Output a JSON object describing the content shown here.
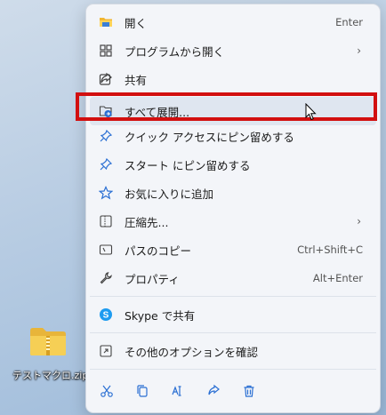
{
  "desktop": {
    "file_label": "テストマクロ.zip"
  },
  "menu": {
    "items": [
      {
        "label": "開く",
        "shortcut": "Enter",
        "icon": "folder-open-icon"
      },
      {
        "label": "プログラムから開く",
        "shortcut": "",
        "icon": "apps-icon",
        "submenu": true
      },
      {
        "label": "共有",
        "shortcut": "",
        "icon": "share-icon"
      },
      {
        "label": "すべて展開...",
        "shortcut": "",
        "icon": "extract-all-icon"
      },
      {
        "label": "クイック アクセスにピン留めする",
        "shortcut": "",
        "icon": "pin-icon"
      },
      {
        "label": "スタート にピン留めする",
        "shortcut": "",
        "icon": "pin-icon"
      },
      {
        "label": "お気に入りに追加",
        "shortcut": "",
        "icon": "star-icon"
      },
      {
        "label": "圧縮先...",
        "shortcut": "",
        "icon": "compress-icon",
        "submenu": true
      },
      {
        "label": "パスのコピー",
        "shortcut": "Ctrl+Shift+C",
        "icon": "copy-path-icon"
      },
      {
        "label": "プロパティ",
        "shortcut": "Alt+Enter",
        "icon": "wrench-icon"
      },
      {
        "label": "Skype で共有",
        "shortcut": "",
        "icon": "skype-icon"
      },
      {
        "label": "その他のオプションを確認",
        "shortcut": "",
        "icon": "more-options-icon"
      }
    ],
    "submenu_arrow": "›"
  },
  "colors": {
    "highlight_border": "#d20f0f",
    "menu_bg": "#f3f5f9",
    "icon_blue": "#2a6fd3"
  }
}
